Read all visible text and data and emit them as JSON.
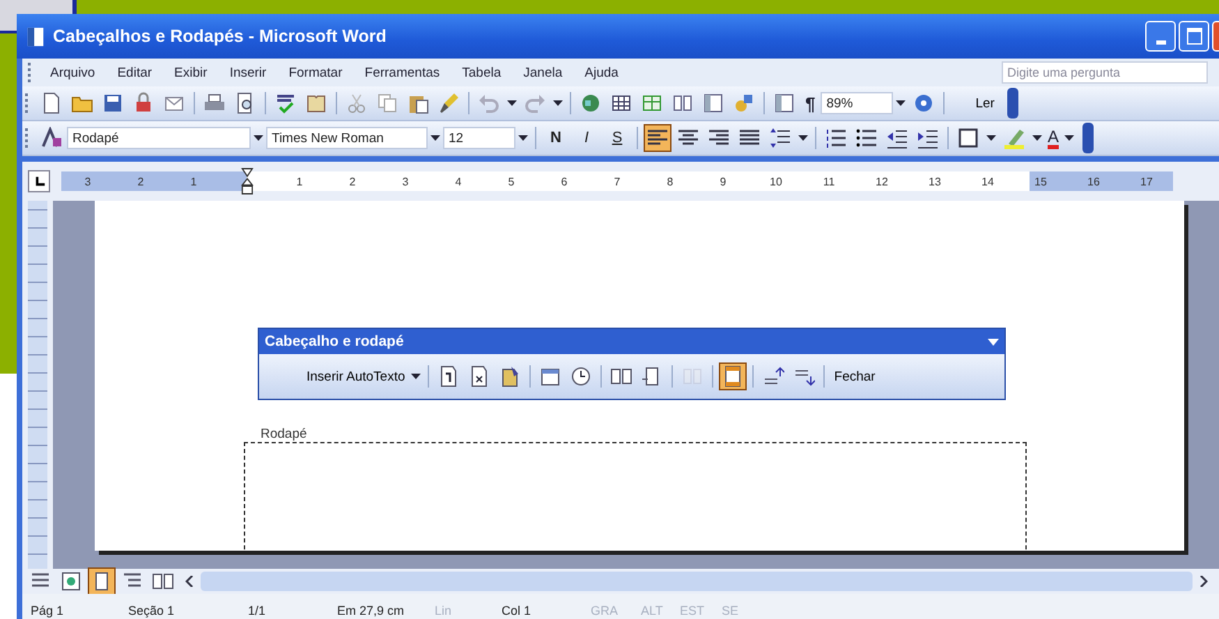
{
  "window": {
    "title": "Cabeçalhos e Rodapés - Microsoft Word"
  },
  "menu": [
    "Arquivo",
    "Editar",
    "Exibir",
    "Inserir",
    "Formatar",
    "Ferramentas",
    "Tabela",
    "Janela",
    "Ajuda"
  ],
  "help_box": {
    "placeholder": "Digite uma pergunta"
  },
  "standard_toolbar": {
    "show_marks": "¶",
    "zoom": "89%",
    "read_button": "Ler"
  },
  "formatting_toolbar": {
    "style": "Rodapé",
    "font": "Times New Roman",
    "size": "12",
    "bold": "N",
    "italic": "I",
    "underline": "S",
    "font_color": "A",
    "align": [
      {
        "selected": true
      },
      {
        "selected": false
      },
      {
        "selected": false
      },
      {
        "selected": false
      }
    ]
  },
  "ruler": {
    "labels": [
      "3",
      "2",
      "1",
      "1",
      "2",
      "3",
      "4",
      "5",
      "6",
      "7",
      "8",
      "9",
      "10",
      "11",
      "12",
      "13",
      "14",
      "15",
      "16",
      "17"
    ]
  },
  "header_footer_toolbar": {
    "title": "Cabeçalho e rodapé",
    "autotext": "Inserir AutoTexto",
    "close": "Fechar",
    "buttons": [
      {
        "selected": false,
        "disabled": false
      },
      {
        "selected": false,
        "disabled": false
      },
      {
        "selected": false,
        "disabled": false
      },
      {
        "selected": false,
        "disabled": false
      },
      {
        "selected": false,
        "disabled": false
      },
      {
        "selected": false,
        "disabled": false
      },
      {
        "selected": false,
        "disabled": false
      },
      {
        "selected": false,
        "disabled": true
      },
      {
        "selected": true,
        "disabled": false
      },
      {
        "selected": false,
        "disabled": false
      },
      {
        "selected": false,
        "disabled": false
      }
    ]
  },
  "footer": {
    "label": "Rodapé"
  },
  "view_buttons": [
    {
      "selected": false
    },
    {
      "selected": false
    },
    {
      "selected": true
    },
    {
      "selected": false
    },
    {
      "selected": false
    }
  ],
  "status_bar": [
    {
      "text": "Pág 1",
      "disabled": false
    },
    {
      "text": "Seção 1",
      "disabled": false
    },
    {
      "text": "1/1",
      "disabled": false
    },
    {
      "text": "Em 27,9 cm",
      "disabled": false
    },
    {
      "text": "Lin",
      "disabled": true
    },
    {
      "text": "Col 1",
      "disabled": false
    },
    {
      "text": "GRA",
      "disabled": true
    },
    {
      "text": "ALT",
      "disabled": true
    },
    {
      "text": "EST",
      "disabled": true
    },
    {
      "text": "SE",
      "disabled": true
    }
  ]
}
